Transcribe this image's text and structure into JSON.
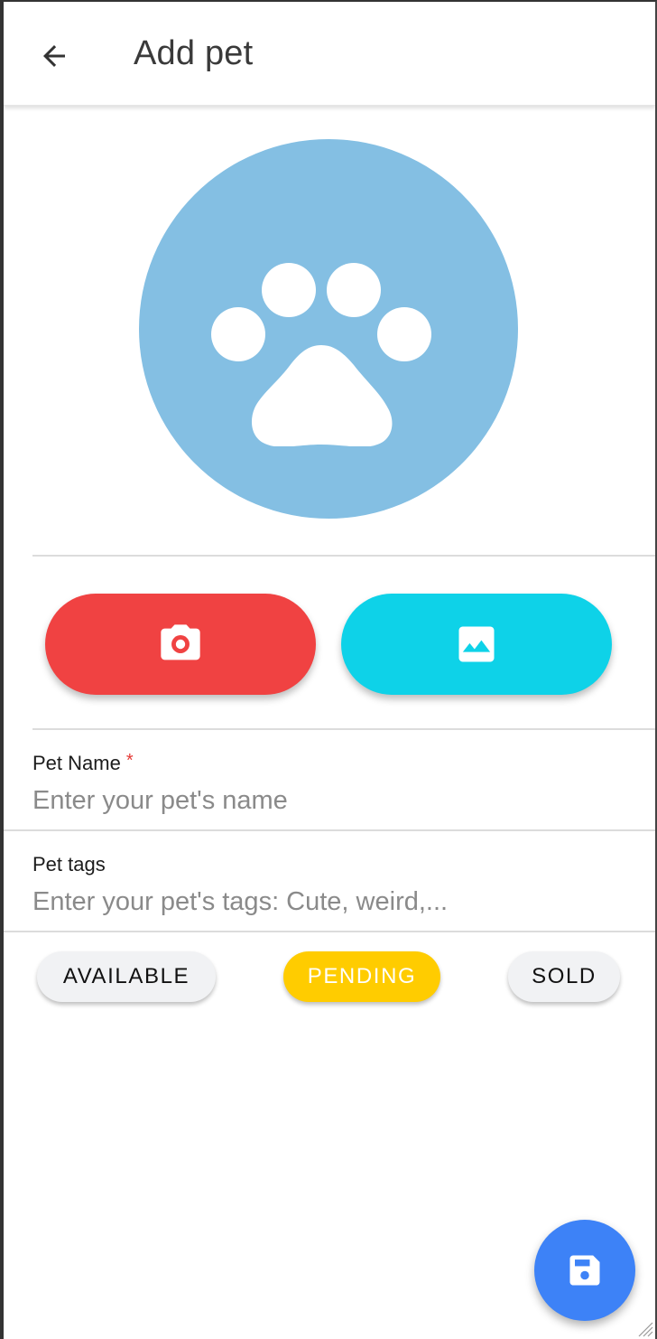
{
  "app_bar": {
    "title": "Add pet",
    "back_icon": "arrow-back-icon"
  },
  "avatar": {
    "icon": "paw-icon",
    "color": "#84bfe3"
  },
  "photo_actions": {
    "camera": {
      "icon": "camera-icon",
      "color": "#f04242"
    },
    "gallery": {
      "icon": "image-icon",
      "color": "#0ed2e8"
    }
  },
  "form": {
    "pet_name": {
      "label": "Pet Name",
      "required_mark": "*",
      "placeholder": "Enter your pet's name",
      "value": ""
    },
    "pet_tags": {
      "label": "Pet tags",
      "placeholder": "Enter your pet's tags: Cute, weird,...",
      "value": ""
    }
  },
  "status_chips": [
    {
      "label": "AVAILABLE",
      "selected": false
    },
    {
      "label": "PENDING",
      "selected": true,
      "color": "#ffcc00"
    },
    {
      "label": "SOLD",
      "selected": false
    }
  ],
  "fab": {
    "icon": "save-icon",
    "color": "#3d82f7"
  }
}
